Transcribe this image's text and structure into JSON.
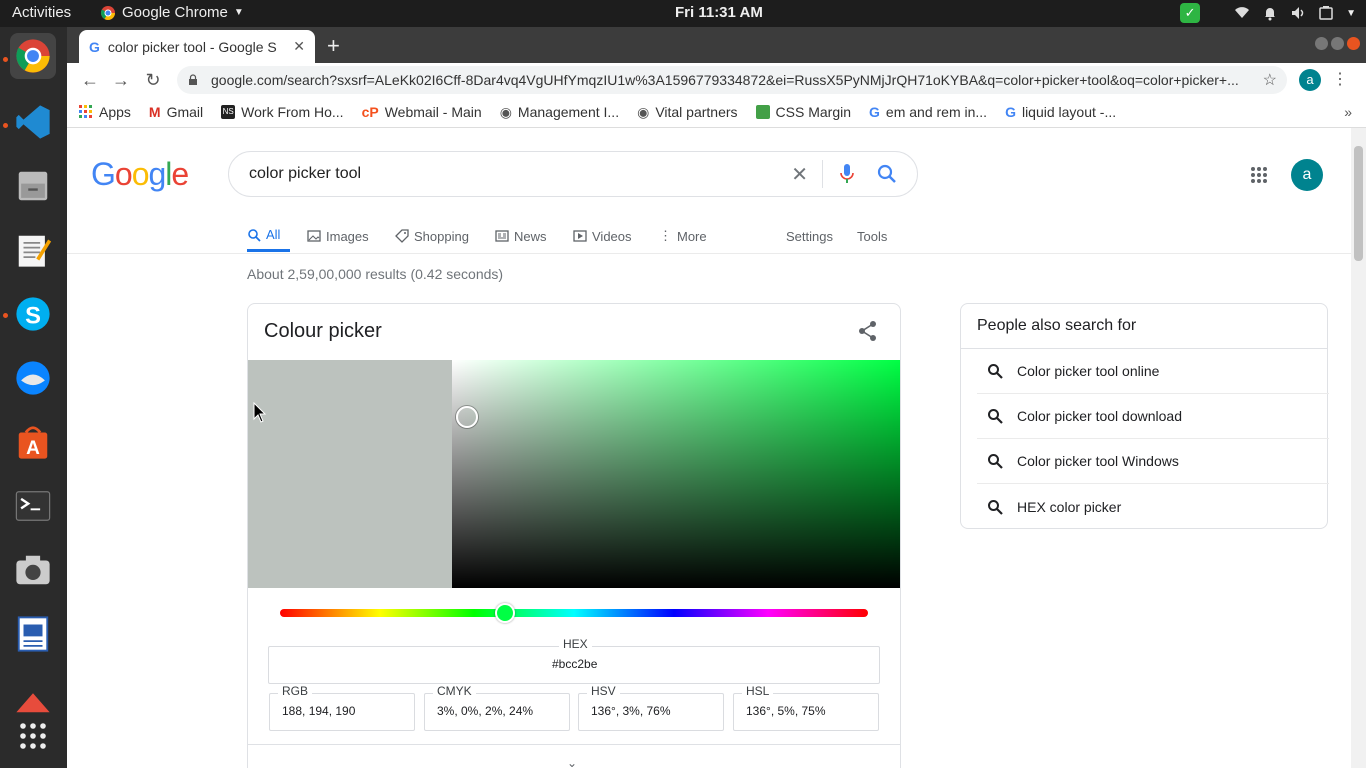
{
  "system": {
    "activities": "Activities",
    "app_name": "Google Chrome",
    "clock": "Fri 11:31 AM"
  },
  "browser": {
    "tab_title": "color picker tool - Google S",
    "url": "google.com/search?sxsrf=ALeKk02I6Cff-8Dar4vq4VgUHfYmqzIU1w%3A1596779334872&ei=RussX5PyNMjJrQH71oKYBA&q=color+picker+tool&oq=color+picker+...",
    "profile_initial": "a",
    "bookmarks": [
      {
        "label": "Apps",
        "color": "#4285f4"
      },
      {
        "label": "Gmail",
        "color": "#d93025"
      },
      {
        "label": "Work From Ho...",
        "color": "#222222"
      },
      {
        "label": "Webmail - Main",
        "color": "#f4511e"
      },
      {
        "label": "Management I...",
        "color": "#555555"
      },
      {
        "label": "Vital partners",
        "color": "#555555"
      },
      {
        "label": "CSS Margin",
        "color": "#43a047"
      },
      {
        "label": "em and rem in...",
        "color": "#4285f4"
      },
      {
        "label": "liquid layout -...",
        "color": "#4285f4"
      }
    ]
  },
  "search": {
    "logo": [
      "G",
      "o",
      "o",
      "g",
      "l",
      "e"
    ],
    "logo_colors": [
      "#4285f4",
      "#ea4335",
      "#fbbc05",
      "#4285f4",
      "#34a853",
      "#ea4335"
    ],
    "query": "color picker tool",
    "avatar_initial": "a",
    "tabs": {
      "all": "All",
      "images": "Images",
      "shopping": "Shopping",
      "news": "News",
      "videos": "Videos",
      "more": "More",
      "settings": "Settings",
      "tools": "Tools"
    },
    "result_stats": "About 2,59,00,000 results (0.42 seconds)"
  },
  "color_picker": {
    "title": "Colour picker",
    "selected_color": "#bcc2be",
    "hue_color": "#00ff44",
    "hex_label": "HEX",
    "hex_value": "#bcc2be",
    "rgb_label": "RGB",
    "rgb_value": "188, 194, 190",
    "cmyk_label": "CMYK",
    "cmyk_value": "3%, 0%, 2%, 24%",
    "hsv_label": "HSV",
    "hsv_value": "136°, 3%, 76%",
    "hsl_label": "HSL",
    "hsl_value": "136°, 5%, 75%"
  },
  "people_also_search": {
    "title": "People also search for",
    "items": [
      "Color picker tool online",
      "Color picker tool download",
      "Color picker tool Windows",
      "HEX color picker"
    ]
  }
}
